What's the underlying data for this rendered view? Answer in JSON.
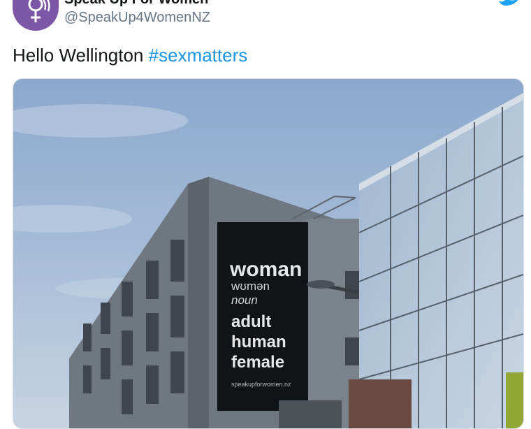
{
  "tweet": {
    "author_name": "Speak Up For Women",
    "author_handle": "@SpeakUp4WomenNZ",
    "text_prefix": "Hello Wellington ",
    "hashtag": "#sexmatters",
    "avatar_icon": "female-symbol-icon",
    "platform_icon": "twitter-bird-icon"
  },
  "billboard": {
    "word": "woman",
    "pronunciation": "wʊmən",
    "part_of_speech": "noun",
    "line1": "adult",
    "line2": "human",
    "line3": "female",
    "url": "speakupforwomen.nz"
  },
  "colors": {
    "brand_purple": "#7e56a6",
    "hashtag_blue": "#1b95e0",
    "twitter_blue": "#1da1f2"
  }
}
